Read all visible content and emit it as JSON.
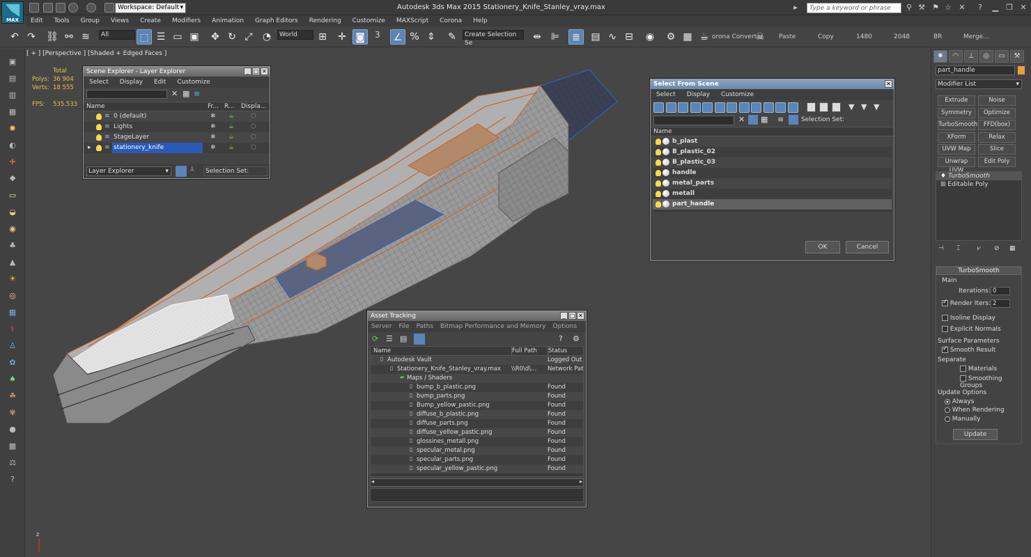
{
  "app": {
    "title": "Autodesk 3ds Max  2015     Stationery_Knife_Stanley_vray.max",
    "logo_text": "MAX",
    "workspace": "Workspace: Default",
    "search_placeholder": "Type a keyword or phrase"
  },
  "menu": [
    "Edit",
    "Tools",
    "Group",
    "Views",
    "Create",
    "Modifiers",
    "Animation",
    "Graph Editors",
    "Rendering",
    "Customize",
    "MAXScript",
    "Corona",
    "Help"
  ],
  "toolbar": {
    "filter": "All",
    "coord": "World",
    "percent": "3",
    "selection_set": "Create Selection Se",
    "corona_convert": "orona Convert",
    "paste": "Paste",
    "copy": "Copy",
    "w": "1480",
    "h": "2048",
    "br": "BR",
    "merge": "Merge..."
  },
  "viewport": {
    "label": "[ + ] [Perspective ] [Shaded + Edged Faces ]",
    "stats": {
      "total_label": "Total",
      "polys_label": "Polys:",
      "polys": "36 904",
      "verts_label": "Verts:",
      "verts": "18 555",
      "fps_label": "FPS:",
      "fps": "535.533"
    }
  },
  "scene_explorer": {
    "title": "Scene Explorer - Layer Explorer",
    "menu": [
      "Select",
      "Display",
      "Edit",
      "Customize"
    ],
    "columns": [
      "Name",
      "Fr...",
      "R...",
      "Displa..."
    ],
    "layers": [
      "0 (default)",
      "Lights",
      "StageLayer",
      "stationery_knife"
    ],
    "footer_dropdown": "Layer Explorer",
    "footer_selset": "Selection Set:"
  },
  "select_from_scene": {
    "title": "Select From Scene",
    "menu": [
      "Select",
      "Display",
      "Customize"
    ],
    "selection_set": "Selection Set:",
    "column": "Name",
    "objects": [
      "b_plast",
      "B_plastic_02",
      "B_plastic_03",
      "handle",
      "metal_parts",
      "metall",
      "part_handle"
    ],
    "ok": "OK",
    "cancel": "Cancel"
  },
  "asset_tracking": {
    "title": "Asset Tracking",
    "menu": [
      "Server",
      "File",
      "Paths",
      "Bitmap Performance and Memory",
      "Options"
    ],
    "columns": [
      "Name",
      "Full Path",
      "Status"
    ],
    "rows": [
      {
        "name": "Autodesk Vault",
        "path": "",
        "status": "Logged Out (..."
      },
      {
        "name": "Stationery_Knife_Stanley_vray.max",
        "path": "\\\\R0\\d\\...",
        "status": "Network Path"
      },
      {
        "name": "Maps / Shaders",
        "path": "",
        "status": ""
      },
      {
        "name": "bump_b_plastic.png",
        "path": "",
        "status": "Found"
      },
      {
        "name": "bump_parts.png",
        "path": "",
        "status": "Found"
      },
      {
        "name": "Bump_yellow_pastic.png",
        "path": "",
        "status": "Found"
      },
      {
        "name": "diffuse_b_plastic.png",
        "path": "",
        "status": "Found"
      },
      {
        "name": "diffuse_parts.png",
        "path": "",
        "status": "Found"
      },
      {
        "name": "diffuse_yellow_pastic.png",
        "path": "",
        "status": "Found"
      },
      {
        "name": "glossines_metall.png",
        "path": "",
        "status": "Found"
      },
      {
        "name": "specular_metal.png",
        "path": "",
        "status": "Found"
      },
      {
        "name": "specular_parts.png",
        "path": "",
        "status": "Found"
      },
      {
        "name": "specular_yellow_pastic.png",
        "path": "",
        "status": "Found"
      }
    ]
  },
  "command_panel": {
    "object_name": "part_handle",
    "modifier_list": "Modifier List",
    "mod_buttons": [
      "Extrude",
      "Noise",
      "Symmetry",
      "Optimize",
      "TurboSmooth",
      "FFD(box)",
      "XForm",
      "Relax",
      "UVW Map",
      "Slice",
      "Unwrap UVW",
      "Edit Poly"
    ],
    "stack": [
      "TurboSmooth",
      "Editable Poly"
    ],
    "rollout_title": "TurboSmooth",
    "main_label": "Main",
    "iterations_label": "Iterations:",
    "iterations": "0",
    "render_iters_label": "Render Iters:",
    "render_iters": "2",
    "isoline": "Isoline Display",
    "explicit_normals": "Explicit Normals",
    "surface_params": "Surface Parameters",
    "smooth_result": "Smooth Result",
    "separate": "Separate",
    "materials": "Materials",
    "smoothing_groups": "Smoothing Groups",
    "update_options": "Update Options",
    "always": "Always",
    "when_rendering": "When Rendering",
    "manually": "Manually",
    "update": "Update"
  },
  "colors": {
    "accent": "#5b84b8",
    "title_active": "#6a87aa",
    "stats": "#e6c14a",
    "mesh": "#9a9a9a",
    "wire_orange": "#c8662a",
    "wire_blue": "#2f5fb8"
  }
}
